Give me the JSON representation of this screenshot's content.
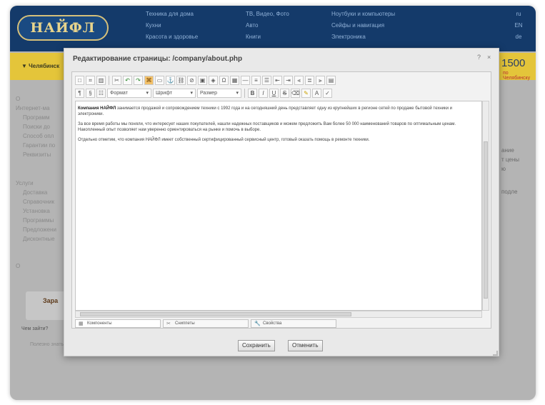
{
  "site": {
    "logo": "НАЙФЛ",
    "nav_col1": [
      "Техника для дома",
      "Кухни",
      "Красота и здоровье"
    ],
    "nav_col2": [
      "ТВ, Видео, Фото",
      "Авто",
      "Книги"
    ],
    "nav_col3": [
      "Ноутбуки и компьютеры",
      "Сейфы и навигация",
      "Электроника"
    ],
    "nav_right": [
      "ru",
      "EN",
      "de"
    ],
    "yellow_left": "Челябинск",
    "yellow_right": "1500",
    "yellow_right_sub": "по Челябинску"
  },
  "background": {
    "left_lines": [
      "О",
      "Интернет-ма",
      "Программ",
      "Поиски до",
      "Способ опл",
      "Гарантии по",
      "Реквизиты"
    ],
    "left_lines2": [
      "Услуги",
      "Доставка",
      "Справочник",
      "Установка",
      "Программы",
      "Предложени",
      "Дисконтные"
    ],
    "left_lines3": [
      "О"
    ],
    "right_lines": [
      "ание",
      "т цены",
      "ю"
    ],
    "right_single": "подле",
    "box_title": "Зара",
    "box_sub": "Чем зайти?",
    "left_line4": "Полезно знать"
  },
  "dialog": {
    "title": "Редактирование страницы: /company/about.php",
    "ctrl_help": "?",
    "ctrl_close": "×",
    "toolbar": {
      "select_format": "Формат",
      "select_font": "Шрифт",
      "select_size": "Размер"
    },
    "content": {
      "p1_bold": "Компания НАЙФЛ",
      "p1_text": " занимается продажей и сопровождением техники с 1992 года и на сегодняшний день представляет одну из крупнейших в регионе сетей по продаже бытовой техники и электроники.",
      "p2_text": "За все время работы мы поняли, что интересует наших покупателей, нашли надежных поставщиков и можем предложить Вам более 50 000 наименований товаров по оптимальным ценам. Накопленный опыт позволяет нам уверенно ориентироваться на рынке и помочь в выборе.",
      "p3_text": "Отдельно отметим, что компания НАЙФЛ имеет собственный сертифицированный сервисный центр, готовый оказать помощь в ремонте техники."
    },
    "tabs": [
      "Компоненты",
      "Сниппеты",
      "Свойства"
    ],
    "save_label": "Сохранить",
    "cancel_label": "Отменить"
  }
}
